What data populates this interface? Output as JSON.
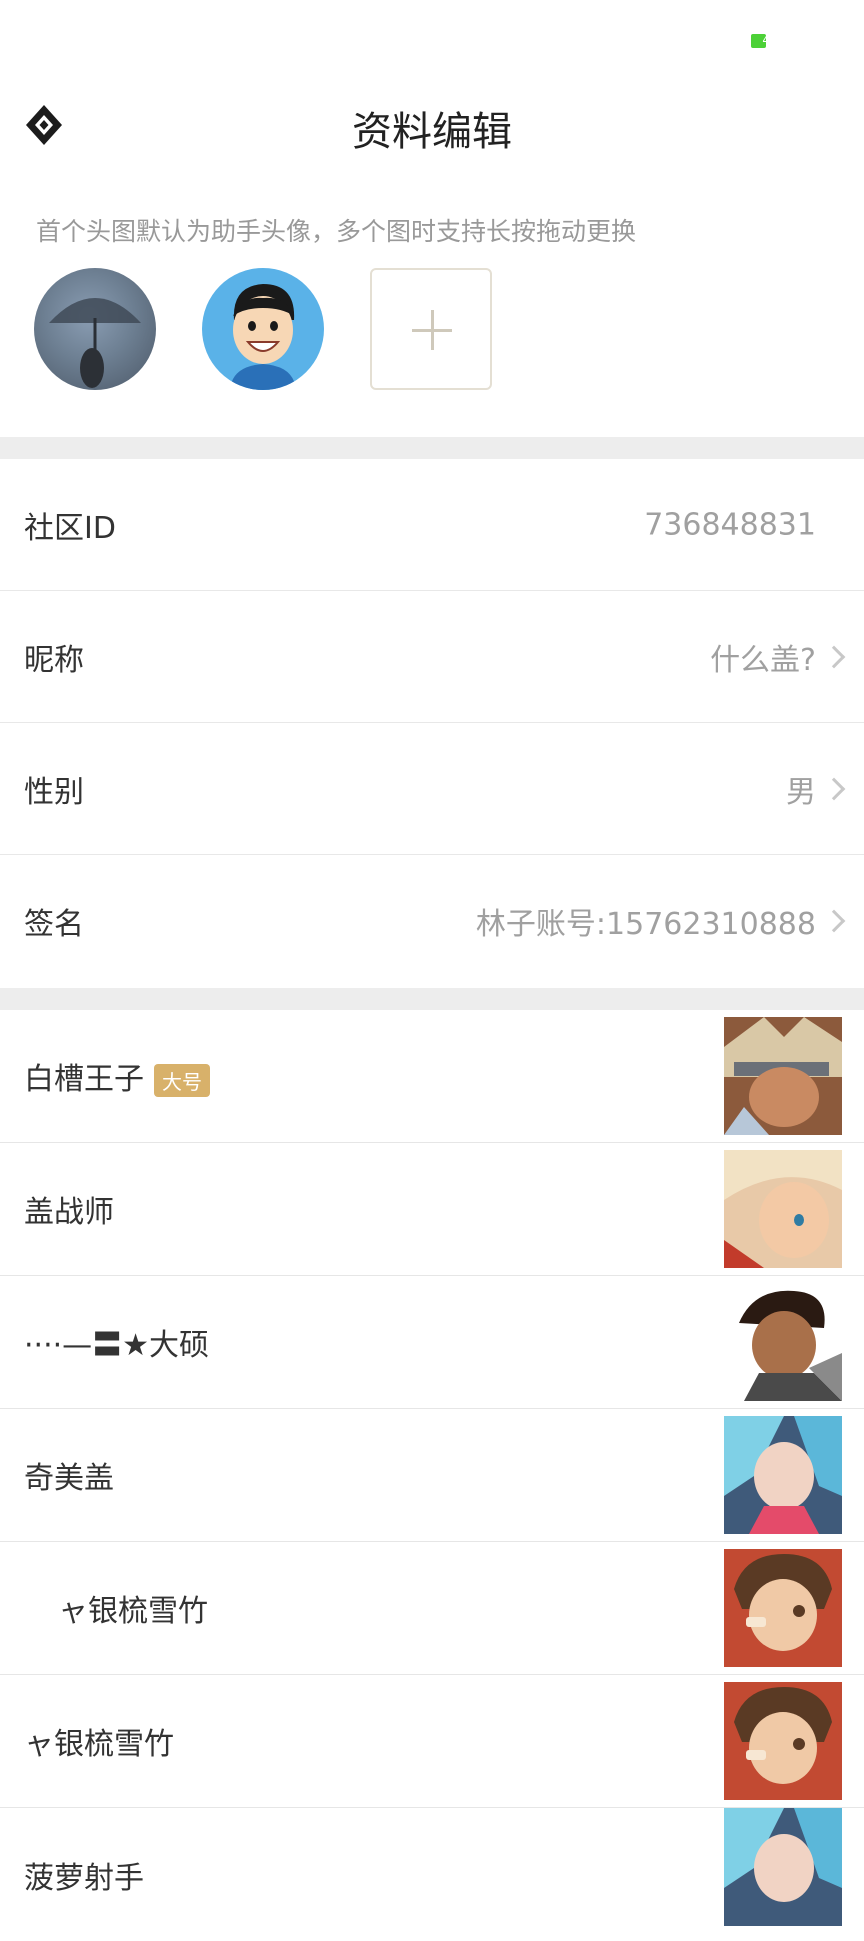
{
  "status_bar": {
    "battery_text": "4",
    "battery_color": "#4cd137"
  },
  "header": {
    "title": "资料编辑",
    "back_icon": "app-logo-diamond-icon"
  },
  "avatars": {
    "hint": "首个头图默认为助手头像，多个图时支持长按拖动更换",
    "add_icon": "plus-icon"
  },
  "profile": {
    "community_id_label": "社区ID",
    "community_id_value": "736848831",
    "nickname_label": "昵称",
    "nickname_value": "什么盖?",
    "gender_label": "性别",
    "gender_value": "男",
    "signature_label": "签名",
    "signature_value": "林子账号:15762310888"
  },
  "characters": [
    {
      "name": "白槽王子",
      "badge": "大号"
    },
    {
      "name": "盖战师"
    },
    {
      "name": "····—〓★大硕"
    },
    {
      "name": "奇美盖"
    },
    {
      "name": "ャ银梳雪竹"
    },
    {
      "name": "ャ银梳雪竹"
    },
    {
      "name": "菠萝射手"
    }
  ],
  "colors": {
    "badge": "#d8b16a",
    "divider": "#ededed",
    "value_text": "#a0a0a0"
  }
}
